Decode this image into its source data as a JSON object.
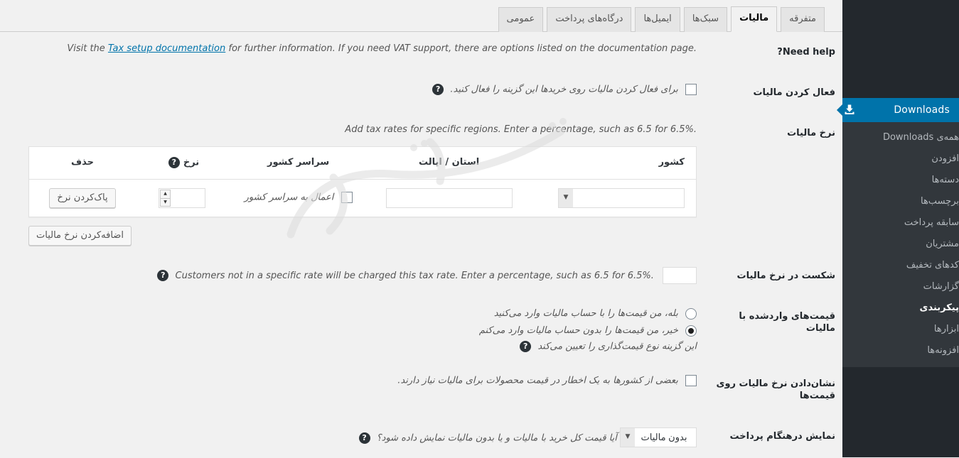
{
  "sidebar": {
    "top_item": {
      "label": "Downloads",
      "icon": "download-icon"
    },
    "items": [
      {
        "label": "همه‌ی Downloads",
        "current": false
      },
      {
        "label": "افزودن",
        "current": false
      },
      {
        "label": "دسته‌ها",
        "current": false
      },
      {
        "label": "برچسب‌ها",
        "current": false
      },
      {
        "label": "سابقه پرداخت",
        "current": false
      },
      {
        "label": "مشتریان",
        "current": false
      },
      {
        "label": "کدهای تخفیف",
        "current": false
      },
      {
        "label": "گزارشات",
        "current": false
      },
      {
        "label": "پیکربندی",
        "current": true
      },
      {
        "label": "ابزارها",
        "current": false
      },
      {
        "label": "افزونه‌ها",
        "current": false
      }
    ]
  },
  "tabs": [
    {
      "label": "متفرقه",
      "active": false
    },
    {
      "label": "مالیات",
      "active": true
    },
    {
      "label": "سبک‌ها",
      "active": false
    },
    {
      "label": "ایمیل‌ها",
      "active": false
    },
    {
      "label": "درگاه‌های پرداخت",
      "active": false
    },
    {
      "label": "عمومی",
      "active": false
    }
  ],
  "rows": {
    "need_help": {
      "label": "Need help?",
      "desc_before": "Visit the ",
      "link": "Tax setup documentation",
      "desc_after": " for further information. If you need VAT support, there are options listed on the documentation page."
    },
    "enable_taxes": {
      "label": "فعال کردن مالیات",
      "desc": "برای فعال کردن مالیات روی خریدها این گزینه را فعال کنید.",
      "checked": false,
      "help": "?"
    },
    "tax_rates": {
      "label": "نرخ مالیات",
      "desc": "Add tax rates for specific regions. Enter a percentage, such as 6.5 for 6.5%.",
      "columns": {
        "country": "کشور",
        "state": "استان / ایالت",
        "country_wide": "سراسر کشور",
        "rate": "نرخ",
        "rate_help": "?",
        "delete": "حذف"
      },
      "row": {
        "country_value": "",
        "state_value": "",
        "countrywide_label": "اعمال به سراسر کشور",
        "countrywide_checked": false,
        "rate_value": "",
        "delete_label": "پاک‌کردن نرخ"
      },
      "add_button": "اضافه‌کردن نرخ مالیات"
    },
    "fallback": {
      "label": "شکست در نرخ مالیات",
      "value": "",
      "desc": "Customers not in a specific rate will be charged this tax rate. Enter a percentage, such as 6.5 for 6.5%.",
      "help": "?"
    },
    "prices_entered": {
      "label": "قیمت‌های واردشده با مالیات",
      "option_yes": "بله، من قیمت‌ها را با حساب مالیات وارد می‌کنید",
      "option_no": "خیر، من قیمت‌ها را بدون حساب مالیات وارد می‌کنم",
      "selected": "no",
      "desc": "این گزینه نوع قیمت‌گذاری را تعیین می‌کند",
      "help": "?"
    },
    "display_tax_rate": {
      "label": "نشان‌دادن نرخ مالیات روی قیمت‌ها",
      "desc": "بعضی از کشورها به یک اخطار در قیمت محصولات برای مالیات نیاز دارند.",
      "checked": false
    },
    "checkout_display": {
      "label": "نمایش درهنگام پرداخت",
      "value": "بدون مالیات",
      "options": [
        "بدون مالیات"
      ],
      "desc": "آیا قیمت کل خرید با مالیات و یا بدون مالیات نمایش داده شود؟",
      "help": "?"
    }
  },
  "colors": {
    "accent": "#0073aa",
    "sidebar_bg": "#23282d",
    "submenu_bg": "#32373c",
    "page_bg": "#f1f1f1"
  }
}
